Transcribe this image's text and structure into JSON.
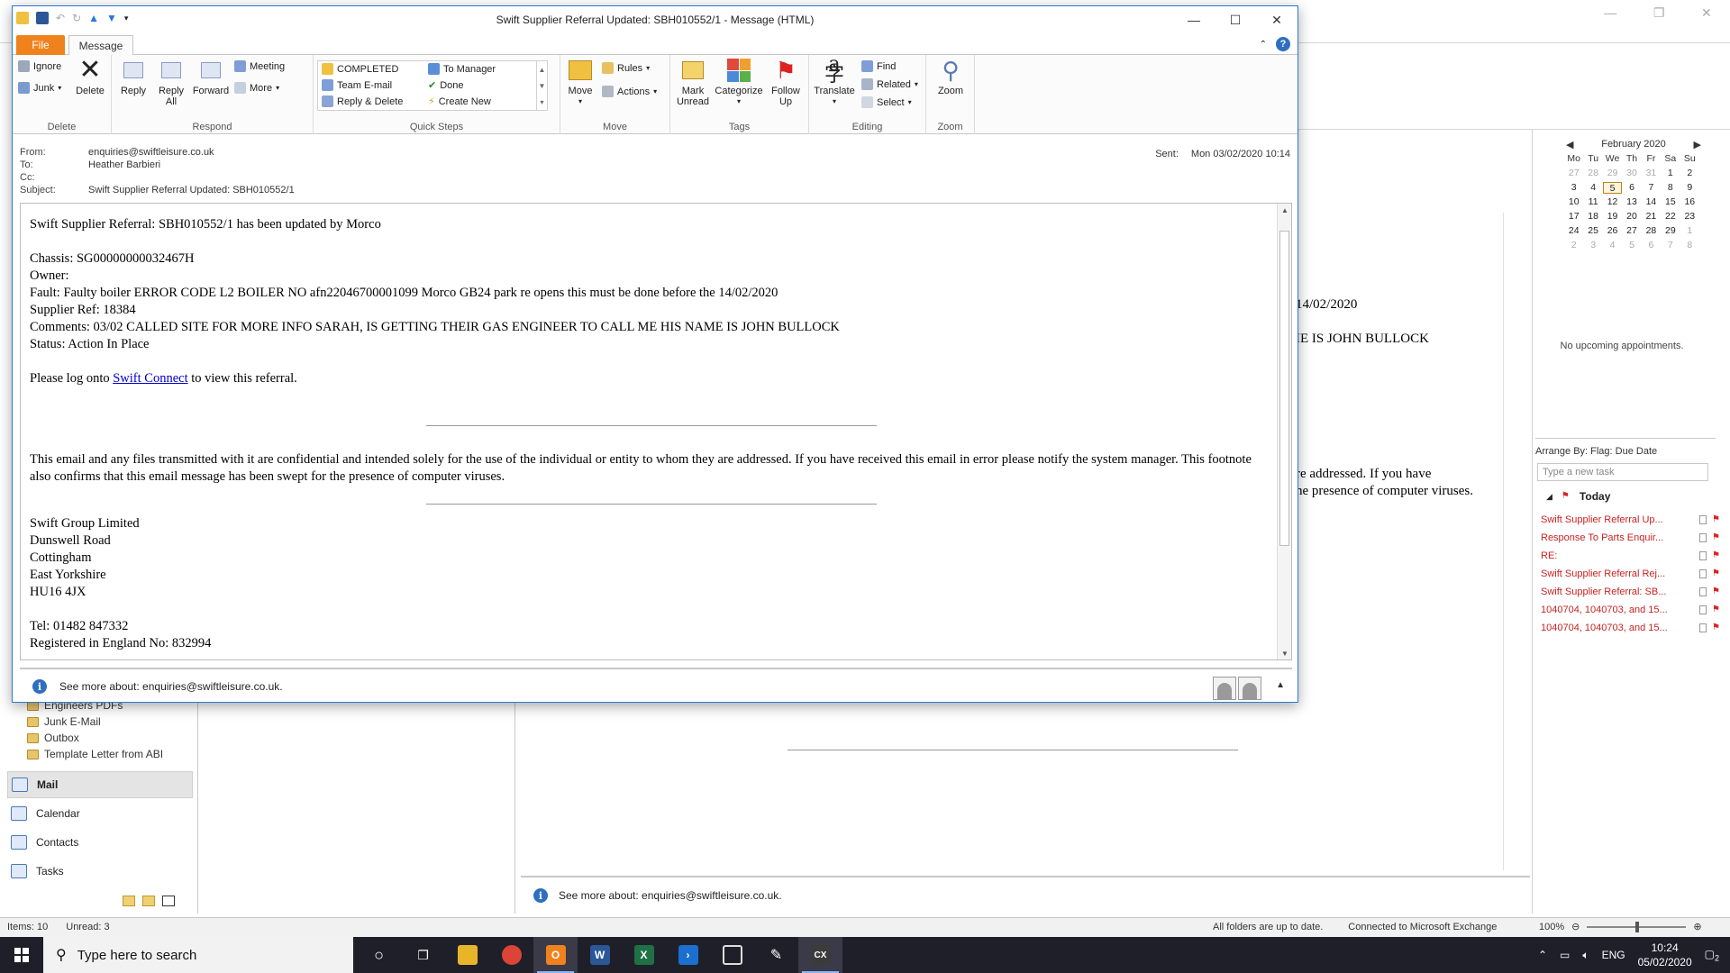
{
  "message_window": {
    "title": "Swift Supplier Referral Updated: SBH010552/1  -  Message (HTML)",
    "tabs": {
      "file": "File",
      "message": "Message"
    },
    "ribbon": {
      "delete_group": {
        "label": "Delete",
        "ignore": "Ignore",
        "junk": "Junk",
        "delete": "Delete"
      },
      "respond_group": {
        "label": "Respond",
        "reply": "Reply",
        "reply_all": "Reply All",
        "forward": "Forward",
        "meeting": "Meeting",
        "more": "More"
      },
      "quick_steps_group": {
        "label": "Quick Steps",
        "completed": "COMPLETED",
        "team_email": "Team E-mail",
        "reply_delete": "Reply & Delete",
        "to_manager": "To Manager",
        "done": "Done",
        "create_new": "Create New"
      },
      "move_group": {
        "label": "Move",
        "move": "Move",
        "rules": "Rules",
        "actions": "Actions"
      },
      "tags_group": {
        "label": "Tags",
        "mark_unread": "Mark Unread",
        "categorize": "Categorize",
        "follow_up": "Follow Up"
      },
      "editing_group": {
        "label": "Editing",
        "translate": "Translate",
        "find": "Find",
        "related": "Related",
        "select": "Select"
      },
      "zoom_group": {
        "label": "Zoom",
        "zoom": "Zoom"
      }
    },
    "header": {
      "from_label": "From:",
      "from": "enquiries@swiftleisure.co.uk",
      "to_label": "To:",
      "to": "Heather Barbieri",
      "cc_label": "Cc:",
      "cc": "",
      "subject_label": "Subject:",
      "subject": "Swift Supplier Referral Updated: SBH010552/1",
      "sent_label": "Sent:",
      "sent": "Mon 03/02/2020 10:14"
    },
    "body": {
      "line1": "Swift Supplier Referral: SBH010552/1 has been updated by Morco",
      "chassis": "Chassis: SG00000000032467H",
      "owner": "Owner:",
      "fault": "Fault: Faulty boiler ERROR CODE L2 BOILER NO afn22046700001099 Morco GB24 park re opens this must be done before the 14/02/2020",
      "supplier_ref": "Supplier Ref: 18384",
      "comments": "Comments: 03/02 CALLED SITE FOR MORE INFO SARAH, IS GETTING THEIR GAS ENGINEER TO CALL ME HIS NAME IS JOHN BULLOCK",
      "status": "Status: Action In Place",
      "login_prefix": "Please log onto ",
      "login_link": "Swift Connect",
      "login_suffix": " to view this referral.",
      "disclaimer": "This email and any files transmitted with it are confidential and intended solely for the use of the individual or entity to whom they are addressed. If you have received this email in error please notify the system manager. This footnote also confirms that this email message has been swept for the presence of computer viruses.",
      "address": [
        "Swift Group Limited",
        "Dunswell Road",
        "Cottingham",
        "East Yorkshire",
        "HU16 4JX"
      ],
      "tel": "Tel: 01482 847332",
      "registered": "Registered in England No: 832994"
    },
    "see_more": "See more about: enquiries@swiftleisure.co.uk."
  },
  "background": {
    "folders": [
      "Engineers PDFs",
      "Junk E-Mail",
      "Outbox",
      "Template Letter from ABI"
    ],
    "nav": {
      "mail": "Mail",
      "calendar": "Calendar",
      "contacts": "Contacts",
      "tasks": "Tasks"
    },
    "reading_fragments": {
      "date_end": "14/02/2020",
      "name_end": "IE IS JOHN BULLOCK",
      "disc1": "re addressed. If you have",
      "disc2": "he presence of computer viruses."
    },
    "see_more": "See more about: enquiries@swiftleisure.co.uk."
  },
  "todo_bar": {
    "month": "February 2020",
    "dow": [
      "Mo",
      "Tu",
      "We",
      "Th",
      "Fr",
      "Sa",
      "Su"
    ],
    "days": [
      [
        "27",
        "28",
        "29",
        "30",
        "31",
        "1",
        "2"
      ],
      [
        "3",
        "4",
        "5",
        "6",
        "7",
        "8",
        "9"
      ],
      [
        "10",
        "11",
        "12",
        "13",
        "14",
        "15",
        "16"
      ],
      [
        "17",
        "18",
        "19",
        "20",
        "21",
        "22",
        "23"
      ],
      [
        "24",
        "25",
        "26",
        "27",
        "28",
        "29",
        "1"
      ],
      [
        "2",
        "3",
        "4",
        "5",
        "6",
        "7",
        "8"
      ]
    ],
    "no_appointments": "No upcoming appointments.",
    "arrange_by": "Arrange By: Flag: Due Date",
    "new_task_placeholder": "Type a new task",
    "today_label": "Today",
    "tasks": [
      "Swift Supplier Referral Up...",
      "Response To Parts Enquir...",
      "RE:",
      "Swift Supplier Referral Rej...",
      "Swift Supplier Referral: SB...",
      "1040704, 1040703, and 15...",
      "1040704, 1040703, and 15..."
    ]
  },
  "status_bar": {
    "items": "Items: 10",
    "unread": "Unread: 3",
    "sync": "All folders are up to date.",
    "connection": "Connected to Microsoft Exchange",
    "zoom": "100%"
  },
  "taskbar": {
    "search_placeholder": "Type here to search",
    "language": "ENG",
    "time": "10:24",
    "date": "05/02/2020",
    "notifications": "2"
  },
  "colors": {
    "accent": "#2b79d6",
    "file_tab": "#f0821e",
    "flag_red": "#c82222",
    "link": "#0000cc"
  }
}
